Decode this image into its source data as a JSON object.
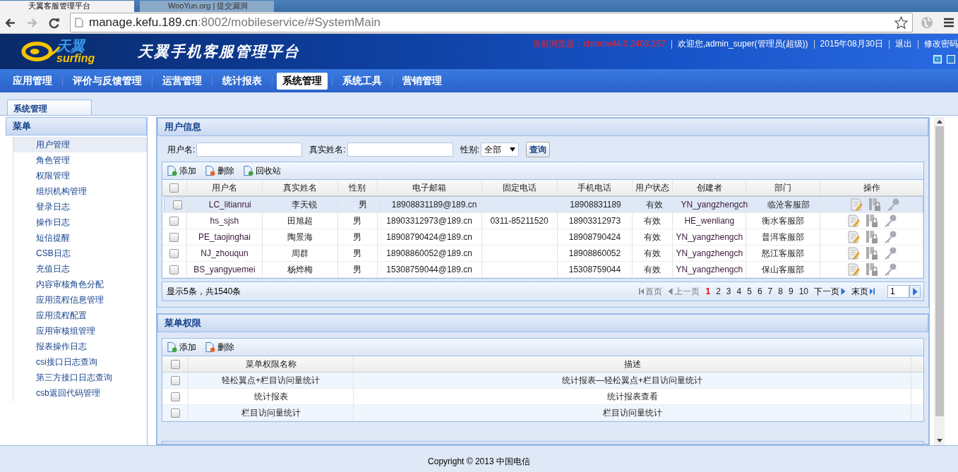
{
  "browser": {
    "tabs": [
      {
        "title": "天翼客服管理平台",
        "selected": true
      },
      {
        "title": "WooYun.org | 提交漏洞",
        "selected": false
      }
    ],
    "address": {
      "host": "manage.kefu.189.cn",
      "path": ":8002/mobileservice/#SystemMain"
    }
  },
  "header": {
    "logo_text": "天翼",
    "logo_sub": "surfing",
    "title": "天翼手机客服管理平台",
    "browser_info": "当前浏览器：chrome44.0.2403.157",
    "welcome": "欢迎您,admin_super(管理员(超级))",
    "date": "2015年08月30日",
    "links": [
      "退出",
      "修改密码"
    ]
  },
  "nav": [
    {
      "label": "应用管理",
      "selected": false
    },
    {
      "label": "评价与反馈管理",
      "selected": false
    },
    {
      "label": "运营管理",
      "selected": false
    },
    {
      "label": "统计报表",
      "selected": false
    },
    {
      "label": "系统管理",
      "selected": true
    },
    {
      "label": "系统工具",
      "selected": false
    },
    {
      "label": "营销管理",
      "selected": false
    }
  ],
  "page_tabs": [
    {
      "label": "系统管理",
      "selected": true
    }
  ],
  "sidebar": {
    "title": "菜单",
    "items": [
      {
        "label": "用户管理",
        "selected": true
      },
      {
        "label": "角色管理",
        "selected": false
      },
      {
        "label": "权限管理",
        "selected": false
      },
      {
        "label": "组织机构管理",
        "selected": false
      },
      {
        "label": "登录日志",
        "selected": false
      },
      {
        "label": "操作日志",
        "selected": false
      },
      {
        "label": "短信提醒",
        "selected": false
      },
      {
        "label": "CSB日志",
        "selected": false
      },
      {
        "label": "充值日志",
        "selected": false
      },
      {
        "label": "内容审核角色分配",
        "selected": false
      },
      {
        "label": "应用流程信息管理",
        "selected": false
      },
      {
        "label": "应用流程配置",
        "selected": false
      },
      {
        "label": "应用审核组管理",
        "selected": false
      },
      {
        "label": "报表操作日志",
        "selected": false
      },
      {
        "label": "csi接口日志查询",
        "selected": false
      },
      {
        "label": "第三方接口日志查询",
        "selected": false
      },
      {
        "label": "csb返回代码管理",
        "selected": false
      }
    ]
  },
  "user_panel": {
    "title": "用户信息",
    "filters": {
      "username_label": "用户名:",
      "realname_label": "真实姓名:",
      "gender_label": "性别:",
      "gender_value": "全部",
      "query_button": "查询"
    },
    "toolbar": [
      {
        "label": "添加",
        "kind": "add"
      },
      {
        "label": "删除",
        "kind": "delete"
      },
      {
        "label": "回收站",
        "kind": "restore"
      }
    ],
    "select_all_checked": false,
    "columns": [
      "用户名",
      "真实姓名",
      "性别",
      "电子邮箱",
      "固定电话",
      "手机电话",
      "用户状态",
      "创建者",
      "部门",
      "操作"
    ],
    "rows": [
      {
        "selected": true,
        "checked": false,
        "cells": [
          "LC_litianrui",
          "李天锐",
          "男",
          "18908831189@189.cn",
          "",
          "18908831189",
          "有效",
          "YN_yangzhengch",
          "临沧客服部"
        ]
      },
      {
        "selected": false,
        "checked": false,
        "cells": [
          "hs_sjsh",
          "田旭超",
          "男",
          "18903312973@189.cn",
          "0311-85211520",
          "18903312973",
          "有效",
          "HE_wenliang",
          "衡水客服部"
        ]
      },
      {
        "selected": false,
        "checked": false,
        "cells": [
          "PE_taojinghai",
          "陶景海",
          "男",
          "18908790424@189.cn",
          "",
          "18908790424",
          "有效",
          "YN_yangzhengch",
          "普洱客服部"
        ]
      },
      {
        "selected": false,
        "checked": false,
        "cells": [
          "NJ_zhouqun",
          "周群",
          "男",
          "18908860052@189.cn",
          "",
          "18908860052",
          "有效",
          "YN_yangzhengch",
          "怒江客服部"
        ]
      },
      {
        "selected": false,
        "checked": false,
        "cells": [
          "BS_yangyuemei",
          "杨烨梅",
          "男",
          "15308759044@189.cn",
          "",
          "15308759044",
          "有效",
          "YN_yangzhengch",
          "保山客服部"
        ]
      }
    ],
    "summary": "显示5条，共1540条",
    "pager": {
      "first": "首页",
      "prev": "上一页",
      "pages": [
        {
          "label": "1",
          "selected": true
        },
        {
          "label": "2",
          "selected": false
        },
        {
          "label": "3",
          "selected": false
        },
        {
          "label": "4",
          "selected": false
        },
        {
          "label": "5",
          "selected": false
        },
        {
          "label": "6",
          "selected": false
        },
        {
          "label": "7",
          "selected": false
        },
        {
          "label": "8",
          "selected": false
        },
        {
          "label": "9",
          "selected": false
        },
        {
          "label": "10",
          "selected": false
        }
      ],
      "next": "下一页",
      "last": "末页",
      "page_input": "1"
    }
  },
  "perm_panel": {
    "title": "菜单权限",
    "toolbar": [
      {
        "label": "添加",
        "kind": "add"
      },
      {
        "label": "删除",
        "kind": "delete"
      }
    ],
    "select_all_checked": false,
    "columns": [
      "菜单权限名称",
      "描述"
    ],
    "rows": [
      {
        "checked": false,
        "cells": [
          "轻松翼点+栏目访问量统计",
          "统计报表—轻松翼点+栏目访问量统计"
        ]
      },
      {
        "checked": false,
        "cells": [
          "统计报表",
          "统计报表查看"
        ]
      },
      {
        "checked": false,
        "cells": [
          "栏目访问量统计",
          "栏目访问量统计"
        ]
      }
    ]
  },
  "footer": "Copyright © 2013 中国电信"
}
